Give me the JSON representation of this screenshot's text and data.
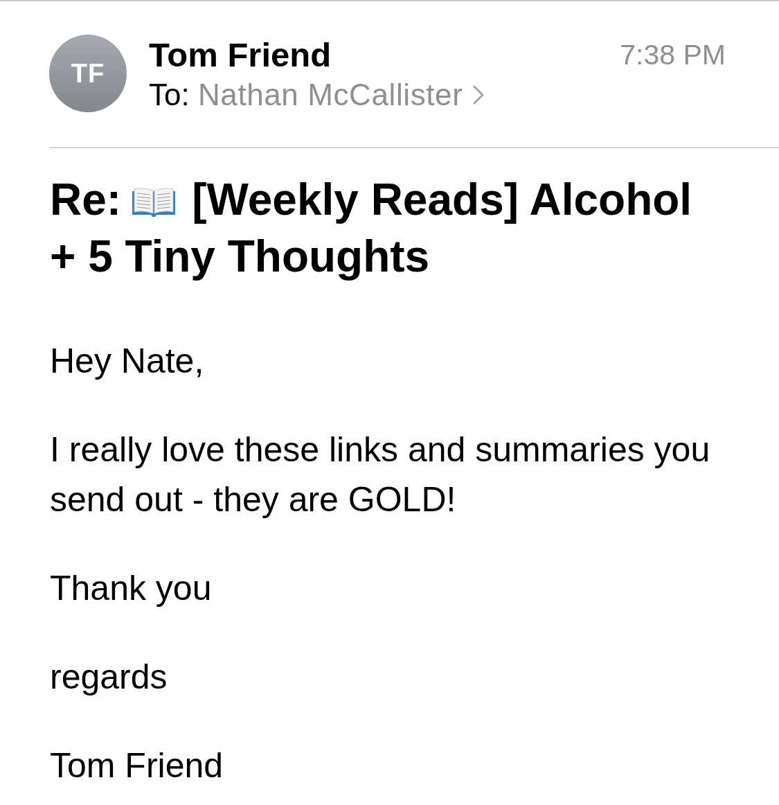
{
  "header": {
    "avatar_initials": "TF",
    "sender": "Tom Friend",
    "to_label": "To:",
    "recipient": "Nathan McCallister",
    "time": "7:38 PM"
  },
  "subject": {
    "prefix": "Re:",
    "text": "[Weekly Reads] Alcohol + 5 Tiny Thoughts"
  },
  "body": [
    "Hey Nate,",
    "I really love these links and summaries you send out - they are GOLD!",
    "Thank you",
    "regards",
    "Tom Friend"
  ]
}
